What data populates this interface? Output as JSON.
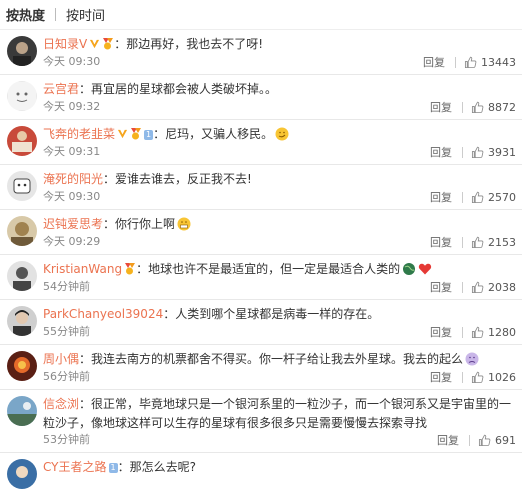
{
  "sort": {
    "hot": "按热度",
    "time": "按时间"
  },
  "reply_label": "回复",
  "sep": "：",
  "comments": [
    {
      "name": "日知录V",
      "text": "那边再好，我也去不了呀!",
      "time": "今天 09:30",
      "likes": "13443"
    },
    {
      "name": "云宫君",
      "text": "再宜居的星球都会被人类破坏掉。。",
      "time": "今天 09:32",
      "likes": "8872"
    },
    {
      "name": "飞奔的老韭菜",
      "lvl": "1",
      "text": "尼玛，又骗人移民。",
      "time": "今天 09:31",
      "likes": "3931"
    },
    {
      "name": "淹死的阳光",
      "text": "爱谁去谁去，反正我不去!",
      "time": "今天 09:30",
      "likes": "2570"
    },
    {
      "name": "迟钝爱思考",
      "text": "你行你上啊",
      "time": "今天 09:29",
      "likes": "2153"
    },
    {
      "name": "KristianWang",
      "text": "地球也许不是最适宜的，但一定是最适合人类的",
      "time": "54分钟前",
      "likes": "2038"
    },
    {
      "name": "ParkChanyeol39024",
      "text": "人类到哪个星球都是病毒一样的存在。",
      "time": "55分钟前",
      "likes": "1280"
    },
    {
      "name": "周小偶",
      "text": "我连去南方的机票都舍不得买。你一杆子给让我去外星球。我去的起么",
      "time": "56分钟前",
      "likes": "1026"
    },
    {
      "name": "信念浏",
      "text": "很正常，毕竟地球只是一个银河系里的一粒沙子，而一个银河系又是宇宙里的一粒沙子，像地球这样可以生存的星球有很多很多只是需要慢慢去探索寻找",
      "time": "53分钟前",
      "likes": "691"
    },
    {
      "name": "CY王者之路",
      "lvl": "1",
      "text": "那怎么去呢?"
    }
  ],
  "colors": {
    "name": "#eb7350",
    "text": "#333333",
    "meta": "#888888"
  }
}
